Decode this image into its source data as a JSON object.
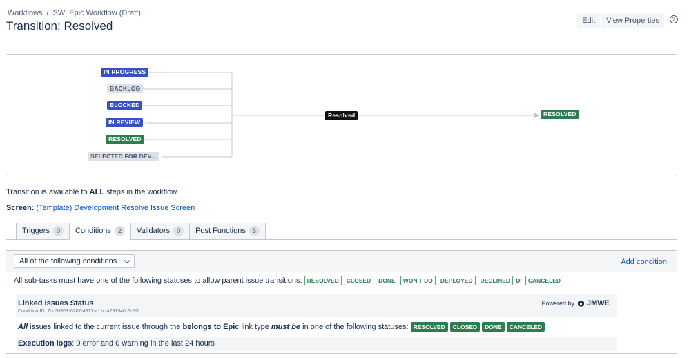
{
  "breadcrumb": {
    "items": [
      "Workflows",
      "SW: Epic Workflow (Draft)"
    ],
    "separator": "/"
  },
  "page_title": "Transition: Resolved",
  "actions": {
    "edit": "Edit",
    "view_properties": "View Properties",
    "help": "?"
  },
  "diagram": {
    "source_statuses": [
      {
        "label": "IN PROGRESS",
        "color": "#3651c8"
      },
      {
        "label": "BACKLOG",
        "color": "#dfe1e6"
      },
      {
        "label": "BLOCKED",
        "color": "#3651c8"
      },
      {
        "label": "IN REVIEW",
        "color": "#3651c8"
      },
      {
        "label": "RESOLVED",
        "color": "#2e7d4f"
      },
      {
        "label": "SELECTED FOR DEV..."
      }
    ],
    "transition_label": "Resolved",
    "target_status": "RESOLVED"
  },
  "availability": {
    "prefix": "Transition is available to",
    "emphasis": "ALL",
    "suffix": "steps in the workflow."
  },
  "screen": {
    "label": "Screen:",
    "link": "(Template) Development Resolve Issue Screen"
  },
  "tabs": [
    {
      "label": "Triggers",
      "count": "0"
    },
    {
      "label": "Conditions",
      "count": "2",
      "active": true
    },
    {
      "label": "Validators",
      "count": "0"
    },
    {
      "label": "Post Functions",
      "count": "5"
    }
  ],
  "conditions_panel": {
    "selector_value": "All of the following conditions",
    "add_condition": "Add condition",
    "subtask_text": "All sub-tasks must have one of the following statuses to allow parent issue transitions:",
    "subtask_statuses": [
      "RESOLVED",
      "CLOSED",
      "DONE",
      "WON'T DO",
      "DEPLOYED",
      "DECLINED"
    ],
    "or_text": "or",
    "subtask_last_status": "CANCELED",
    "linked": {
      "title": "Linked Issues Status",
      "condition_id": "Condition ID: 7bd53951-6207-4377-a11c-a791940c3c93",
      "powered_by": "Powered by",
      "brand": "JMWE",
      "desc_all": "All",
      "desc_1": "issues linked to the current issue through the",
      "desc_link": "belongs to Epic",
      "desc_2": "link type",
      "desc_must": "must be",
      "desc_3": "in one of the following statuses:",
      "statuses": [
        "RESOLVED",
        "CLOSED",
        "DONE",
        "CANCELED"
      ],
      "exec_label": "Execution logs",
      "exec_text": ": 0 error and 0 warning in the last 24 hours"
    }
  },
  "colors": {
    "accent": "#0052cc",
    "green": "#2e7d4f",
    "blue": "#3651c8"
  }
}
